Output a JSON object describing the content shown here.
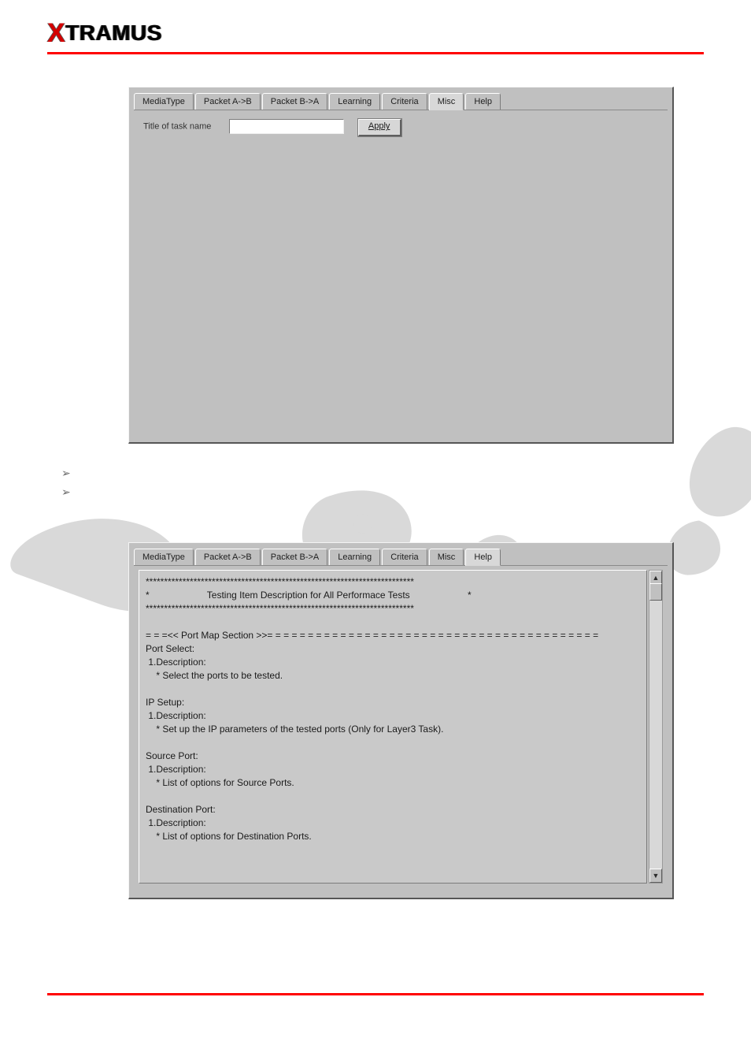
{
  "logo": {
    "prefix": "X",
    "rest": "TRAMUS"
  },
  "tabs": {
    "items": [
      "MediaType",
      "Packet A->B",
      "Packet B->A",
      "Learning",
      "Criteria",
      "Misc",
      "Help"
    ]
  },
  "panel_misc": {
    "active_tab_index": 5,
    "title_label": "Title of task name",
    "title_value": "",
    "apply_label": "Apply"
  },
  "panel_help": {
    "active_tab_index": 6,
    "text_lines": [
      "*************************************************************************",
      "*                      Testing Item Description for All Performace Tests                      *",
      "*************************************************************************",
      "",
      "= = =<< Port Map Section >>= = = = = = = = = = = = = = = = = = = = = = = = = = = = = = = = = = = = = = = = =",
      "Port Select:",
      " 1.Description:",
      "    * Select the ports to be tested.",
      "",
      "IP Setup:",
      " 1.Description:",
      "    * Set up the IP parameters of the tested ports (Only for Layer3 Task).",
      "",
      "Source Port:",
      " 1.Description:",
      "    * List of options for Source Ports.",
      "",
      "Destination Port:",
      " 1.Description:",
      "    * List of options for Destination Ports."
    ]
  },
  "bullets": [
    "",
    ""
  ],
  "scroll": {
    "up": "▲",
    "down": "▼"
  }
}
